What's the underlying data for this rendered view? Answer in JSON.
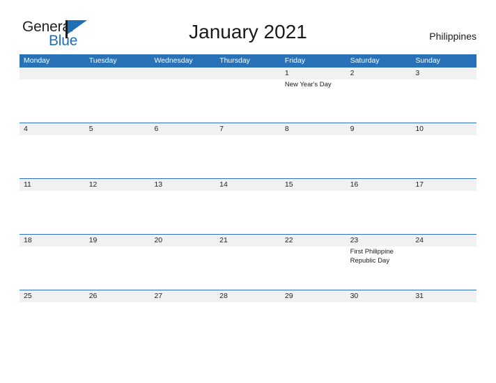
{
  "brand": {
    "name_top": "General",
    "name_bottom": "Blue",
    "flag_color": "#1f6fb5",
    "text_color": "#231f20"
  },
  "header": {
    "title": "January 2021",
    "country": "Philippines",
    "header_bg": "#2a72b8",
    "strip_bg": "#f1f1f1"
  },
  "calendar": {
    "weekdays": [
      "Monday",
      "Tuesday",
      "Wednesday",
      "Thursday",
      "Friday",
      "Saturday",
      "Sunday"
    ],
    "weeks": [
      {
        "days": [
          {
            "num": "",
            "event": ""
          },
          {
            "num": "",
            "event": ""
          },
          {
            "num": "",
            "event": ""
          },
          {
            "num": "",
            "event": ""
          },
          {
            "num": "1",
            "event": "New Year's Day"
          },
          {
            "num": "2",
            "event": ""
          },
          {
            "num": "3",
            "event": ""
          }
        ]
      },
      {
        "days": [
          {
            "num": "4",
            "event": ""
          },
          {
            "num": "5",
            "event": ""
          },
          {
            "num": "6",
            "event": ""
          },
          {
            "num": "7",
            "event": ""
          },
          {
            "num": "8",
            "event": ""
          },
          {
            "num": "9",
            "event": ""
          },
          {
            "num": "10",
            "event": ""
          }
        ]
      },
      {
        "days": [
          {
            "num": "11",
            "event": ""
          },
          {
            "num": "12",
            "event": ""
          },
          {
            "num": "13",
            "event": ""
          },
          {
            "num": "14",
            "event": ""
          },
          {
            "num": "15",
            "event": ""
          },
          {
            "num": "16",
            "event": ""
          },
          {
            "num": "17",
            "event": ""
          }
        ]
      },
      {
        "days": [
          {
            "num": "18",
            "event": ""
          },
          {
            "num": "19",
            "event": ""
          },
          {
            "num": "20",
            "event": ""
          },
          {
            "num": "21",
            "event": ""
          },
          {
            "num": "22",
            "event": ""
          },
          {
            "num": "23",
            "event": "First Philippine Republic Day"
          },
          {
            "num": "24",
            "event": ""
          }
        ]
      },
      {
        "days": [
          {
            "num": "25",
            "event": ""
          },
          {
            "num": "26",
            "event": ""
          },
          {
            "num": "27",
            "event": ""
          },
          {
            "num": "28",
            "event": ""
          },
          {
            "num": "29",
            "event": ""
          },
          {
            "num": "30",
            "event": ""
          },
          {
            "num": "31",
            "event": ""
          }
        ]
      }
    ]
  }
}
